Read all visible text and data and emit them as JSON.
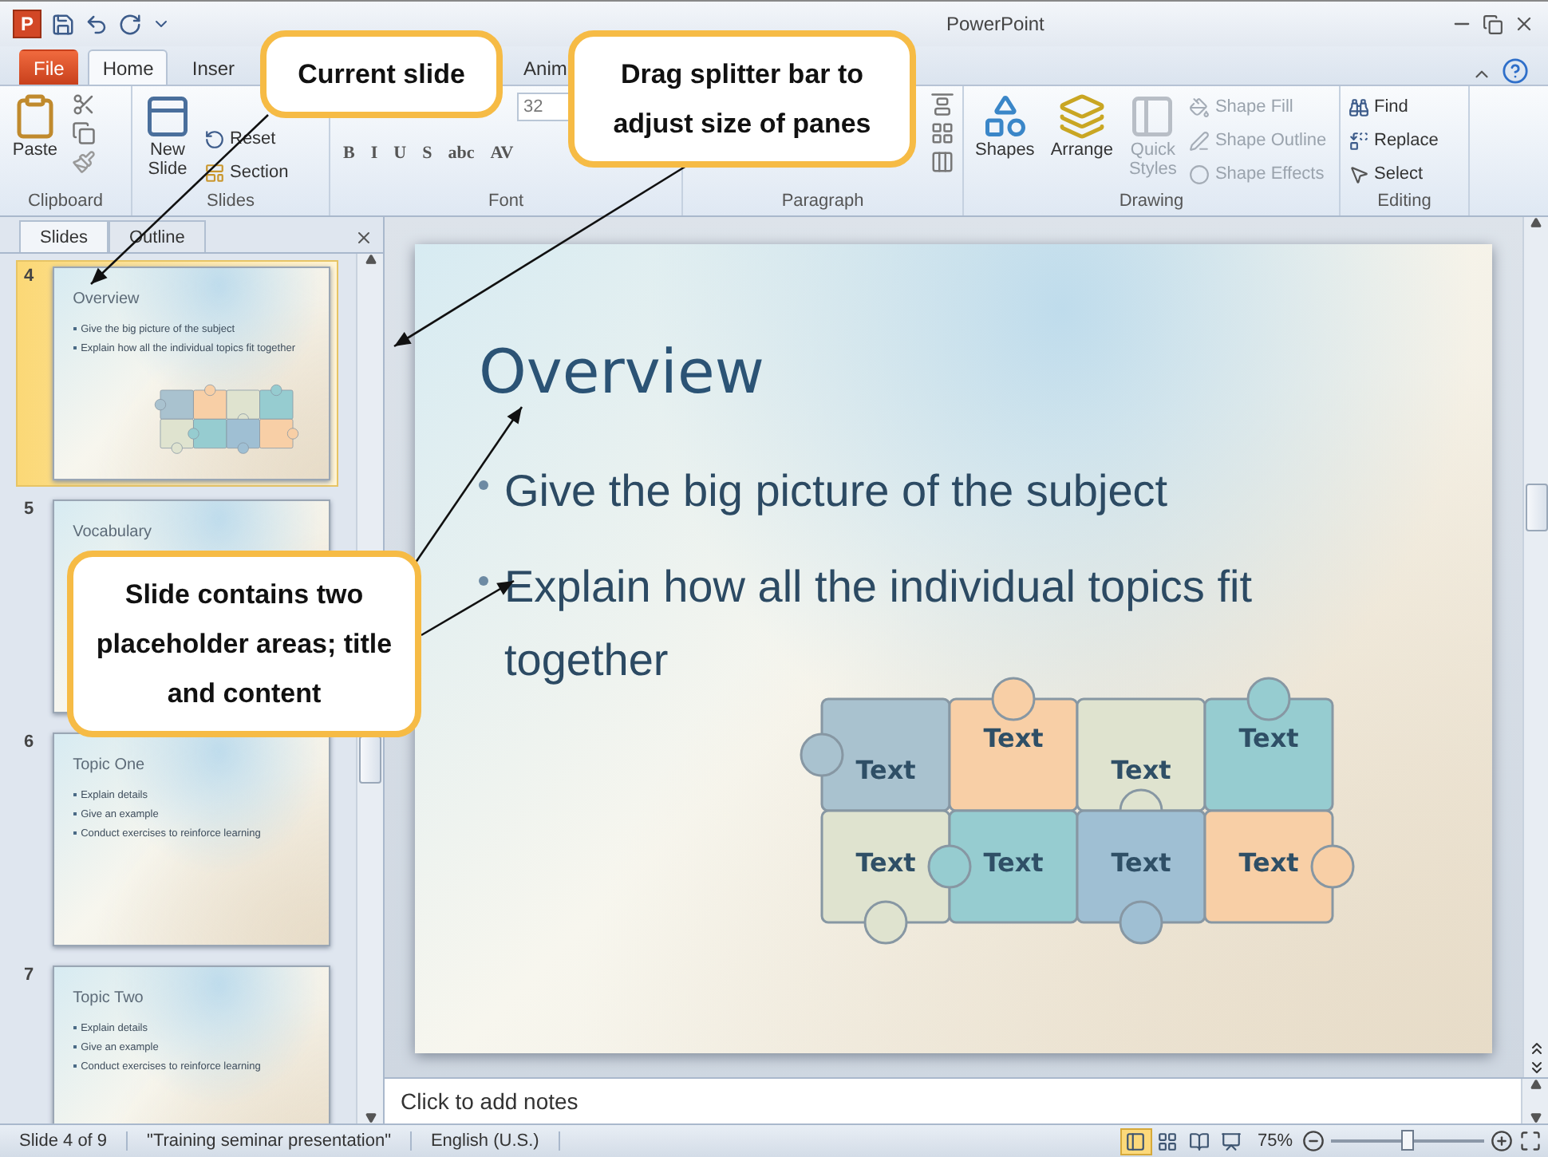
{
  "title_bar": {
    "app_logo": "P",
    "title": "PowerPoint"
  },
  "ribbon_tabs": [
    {
      "label": "File",
      "selected": false,
      "kind": "file"
    },
    {
      "label": "Home",
      "selected": true,
      "kind": "tab"
    },
    {
      "label": "Inser",
      "selected": false,
      "kind": "tab"
    },
    {
      "label": "Anim",
      "selected": false,
      "kind": "tab"
    }
  ],
  "ribbon": {
    "clipboard": {
      "label": "Clipboard",
      "paste": "Paste"
    },
    "slides": {
      "label": "Slides",
      "new_slide": "New Slide",
      "reset": "Reset",
      "section": "Section"
    },
    "font": {
      "label": "Font",
      "size": "32",
      "formats": [
        "B",
        "I",
        "U",
        "S",
        "abc",
        "AV"
      ]
    },
    "paragraph": {
      "label": "Paragraph"
    },
    "drawing": {
      "label": "Drawing",
      "shapes": "Shapes",
      "arrange": "Arrange",
      "quick_styles": {
        "label": "Quick Styles",
        "disabled": true
      },
      "shape_fill": {
        "label": "Shape Fill",
        "disabled": true
      },
      "shape_outline": {
        "label": "Shape Outline",
        "disabled": true
      },
      "shape_effects": {
        "label": "Shape Effects",
        "disabled": true
      }
    },
    "editing": {
      "label": "Editing",
      "find": "Find",
      "replace": "Replace",
      "select": "Select"
    }
  },
  "pane_tabs": [
    {
      "label": "Slides",
      "selected": true
    },
    {
      "label": "Outline",
      "selected": false
    }
  ],
  "thumbnails": [
    {
      "number": "4",
      "title": "Overview",
      "bullets": [
        "Give the big picture of the subject",
        "Explain how all the individual topics fit together"
      ],
      "selected": true,
      "kind": "puzzle"
    },
    {
      "number": "5",
      "title": "Vocabulary",
      "selected": false,
      "kind": "text"
    },
    {
      "number": "6",
      "title": "Topic One",
      "bullets": [
        "Explain details",
        "Give an example",
        "Conduct exercises to reinforce learning"
      ],
      "selected": false,
      "kind": "text"
    },
    {
      "number": "7",
      "title": "Topic Two",
      "bullets": [
        "Explain details",
        "Give an example",
        "Conduct exercises to reinforce learning"
      ],
      "selected": false,
      "kind": "text"
    }
  ],
  "slide": {
    "title": "Overview",
    "bullets": [
      "Give the big picture of the subject",
      "Explain how all the individual topics fit together"
    ],
    "puzzle": [
      {
        "label": "Text",
        "color": "#a9c2cf"
      },
      {
        "label": "Text",
        "color": "#f8cfa6"
      },
      {
        "label": "Text",
        "color": "#dfe3cf"
      },
      {
        "label": "Text",
        "color": "#96ccd0"
      },
      {
        "label": "Text",
        "color": "#dfe3cf"
      },
      {
        "label": "Text",
        "color": "#96ccd0"
      },
      {
        "label": "Text",
        "color": "#9fbfd3"
      },
      {
        "label": "Text",
        "color": "#f8cfa6"
      }
    ]
  },
  "notes": {
    "placeholder": "Click to add notes"
  },
  "status_bar": {
    "items": [
      "Slide 4 of 9",
      "\"Training seminar presentation\"",
      "English (U.S.)"
    ],
    "views": [
      {
        "selected": true
      },
      {
        "selected": false
      },
      {
        "selected": false
      },
      {
        "selected": false
      }
    ],
    "zoom": "75%",
    "zoom_level": {
      "level": 0.5
    }
  },
  "callouts": [
    {
      "text": "Current slide"
    },
    {
      "text": "Drag splitter bar to adjust size of panes"
    },
    {
      "text": "Slide contains two placeholder areas; title and content"
    }
  ]
}
